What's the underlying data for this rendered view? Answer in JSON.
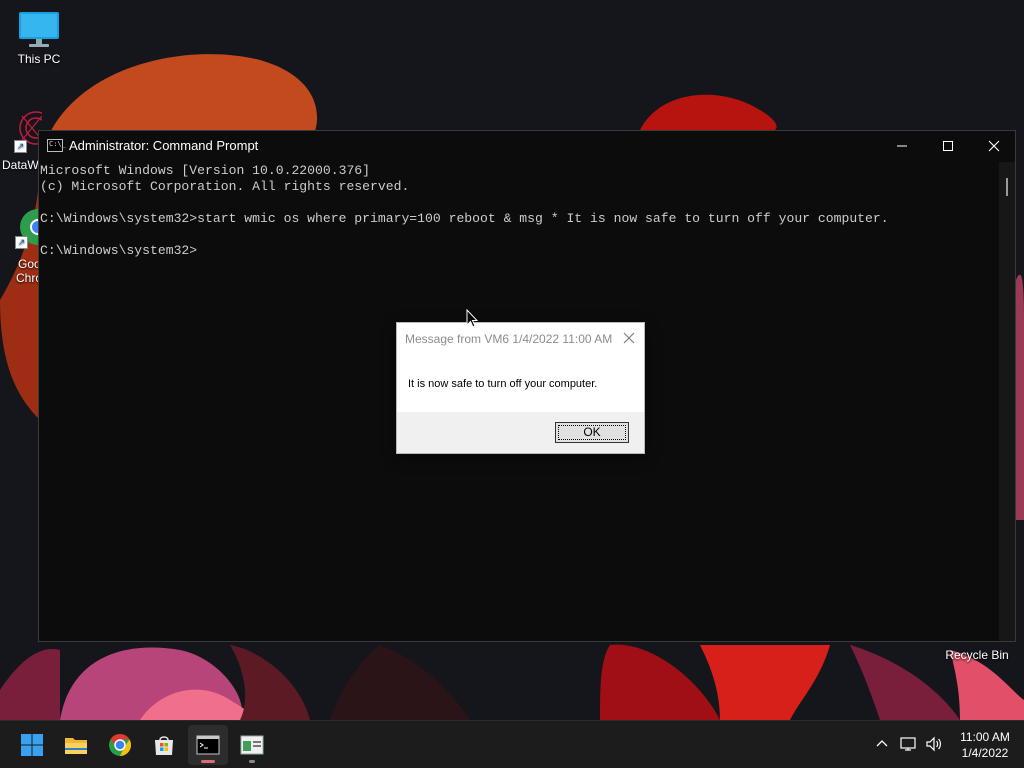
{
  "desktop": {
    "icons": {
      "this_pc": "This PC",
      "datawrapper": "DataW",
      "google_chrome_line1": "Goo",
      "google_chrome_line2": "Chro",
      "recycle_bin": "Recycle Bin"
    }
  },
  "cmd_window": {
    "title": "Administrator: Command Prompt",
    "icon_text": "C:\\_",
    "lines": [
      "Microsoft Windows [Version 10.0.22000.376]",
      "(c) Microsoft Corporation. All rights reserved.",
      "",
      "C:\\Windows\\system32>start wmic os where primary=100 reboot & msg * It is now safe to turn off your computer.",
      "",
      "C:\\Windows\\system32>"
    ]
  },
  "msg_dialog": {
    "title": "Message from VM6 1/4/2022 11:00 AM",
    "text": "It is now safe to turn off your computer.",
    "ok_label": "OK"
  },
  "taskbar": {
    "apps": [
      "start-icon",
      "file-explorer-icon",
      "chrome-icon",
      "store-icon",
      "command-prompt-icon",
      "settings-window-icon"
    ],
    "active_app": "command-prompt-icon",
    "accent_color": "#e06c6c",
    "tray": {
      "time": "11:00 AM",
      "date": "1/4/2022"
    }
  }
}
